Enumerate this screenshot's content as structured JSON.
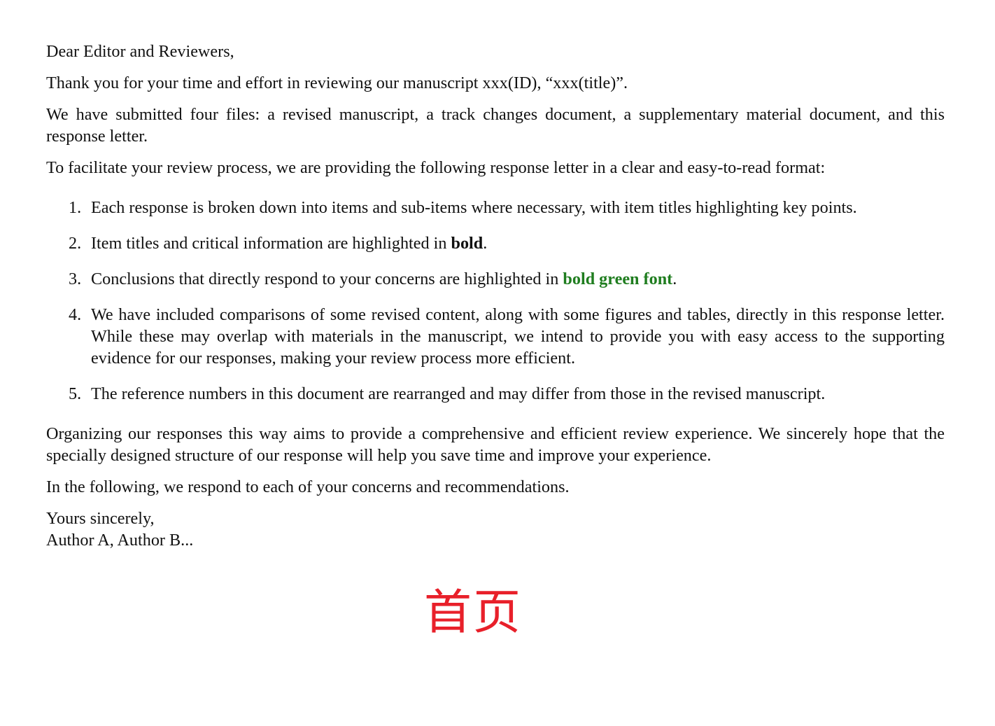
{
  "letter": {
    "greeting": "Dear Editor and Reviewers,",
    "thanks": "Thank you for your time and effort in reviewing our manuscript xxx(ID), “xxx(title)”.",
    "submitted": "We have submitted four files: a revised manuscript, a track changes document, a supplementary material document, and this response letter.",
    "facilitate": "To facilitate your review process, we are providing the following response letter in a clear and easy-to-read format:",
    "items": [
      {
        "num": "1.",
        "text": "Each response is broken down into items and sub-items where necessary, with item titles highlighting key points."
      },
      {
        "num": "2.",
        "pre": "Item titles and critical information are highlighted in ",
        "bold": "bold",
        "post": "."
      },
      {
        "num": "3.",
        "pre": "Conclusions that directly respond to your concerns are highlighted in ",
        "green": "bold green font",
        "post": "."
      },
      {
        "num": "4.",
        "text": "We have included comparisons of some revised content, along with some figures and tables, directly in this response letter.  While these may overlap with materials in the manuscript, we intend to provide you with easy access to the supporting evidence for our responses, making your review process more efficient."
      },
      {
        "num": "5.",
        "text": "The reference numbers in this document are rearranged and may differ from those in the revised manuscript."
      }
    ],
    "organizing": "Organizing our responses this way aims to provide a comprehensive and efficient review experience.  We sincerely hope that the specially designed structure of our response will help you save time and improve your experience.",
    "following": "In the following, we respond to each of your concerns and recommendations.",
    "closing": "Yours sincerely,",
    "authors": "Author A, Author B..."
  },
  "page_label": "首页",
  "colors": {
    "text": "#111111",
    "highlight_green": "#1f7d1f",
    "page_label_red": "#e8202a"
  }
}
